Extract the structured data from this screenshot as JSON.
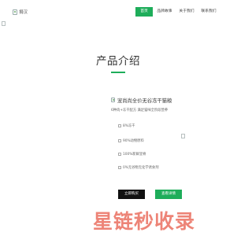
{
  "header": {
    "logo_alt": "捐汉",
    "nav": [
      {
        "label": "首页",
        "active": true
      },
      {
        "label": "品牌故事",
        "active": false
      },
      {
        "label": "关于我们",
        "active": false
      },
      {
        "label": "联系我们",
        "active": false
      }
    ]
  },
  "main": {
    "section_title": "产品介绍",
    "product_name": "宠尚尚全价无谷冻干猫粮",
    "product_subtitle": "6种肉+冻干配方 满足猫咪全阶段营养",
    "features": [
      "8%冻干",
      "90%动物原料",
      "100%新鲜里脊",
      "0%无谷物无化学诱食剂"
    ],
    "buy_button": "立即购买",
    "more_button": "查看详情"
  },
  "watermark": "星链秒收录",
  "colors": {
    "accent": "#1ead5a",
    "button_dark": "#111111",
    "watermark": "#e85b4a"
  }
}
